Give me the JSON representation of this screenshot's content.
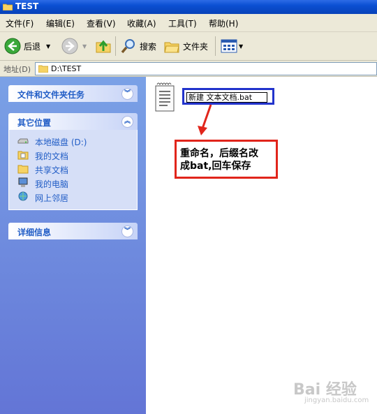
{
  "window": {
    "title": "TEST"
  },
  "menu": [
    "文件(F)",
    "编辑(E)",
    "查看(V)",
    "收藏(A)",
    "工具(T)",
    "帮助(H)"
  ],
  "toolbar": {
    "back_label": "后退",
    "search_label": "搜索",
    "folders_label": "文件夹"
  },
  "address": {
    "label": "地址(D)",
    "value": "D:\\TEST"
  },
  "panels": {
    "tasks": {
      "title": "文件和文件夹任务"
    },
    "places": {
      "title": "其它位置",
      "items": [
        {
          "label": "本地磁盘 (D:)",
          "icon": "disk-icon"
        },
        {
          "label": "我的文档",
          "icon": "documents-folder-icon"
        },
        {
          "label": "共享文档",
          "icon": "shared-folder-icon"
        },
        {
          "label": "我的电脑",
          "icon": "computer-icon"
        },
        {
          "label": "网上邻居",
          "icon": "network-icon"
        }
      ]
    },
    "details": {
      "title": "详细信息"
    }
  },
  "file": {
    "rename_value": "新建 文本文档.bat"
  },
  "callout": {
    "line1": "重命名，后缀名改",
    "line2": "成bat,回车保存"
  },
  "watermark": {
    "main": "Bai 经验",
    "sub": "jingyan.baidu.com"
  }
}
